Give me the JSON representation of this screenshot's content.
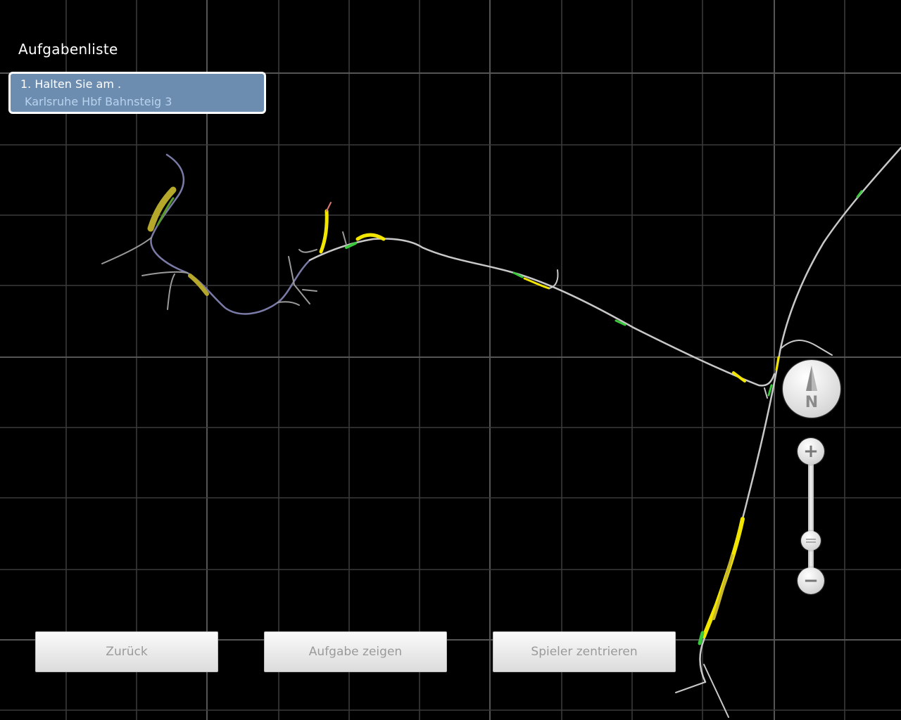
{
  "task_list": {
    "title": "Aufgabenliste",
    "items": [
      {
        "text": "1. Halten Sie am .",
        "location": "Karlsruhe Hbf Bahnsteig 3"
      }
    ]
  },
  "buttons": {
    "back": "Zurück",
    "show_task": "Aufgabe zeigen",
    "center_player": "Spieler zentrieren"
  },
  "compass": {
    "label": "N"
  },
  "zoom": {
    "in_icon": "plus-icon",
    "out_icon": "minus-icon",
    "level": 0.25
  },
  "colors": {
    "background": "#000000",
    "track": "#c8c8c8",
    "platform": "#f2e600",
    "signal": "#3cc83c",
    "task_bg": "#6c8cb0"
  }
}
